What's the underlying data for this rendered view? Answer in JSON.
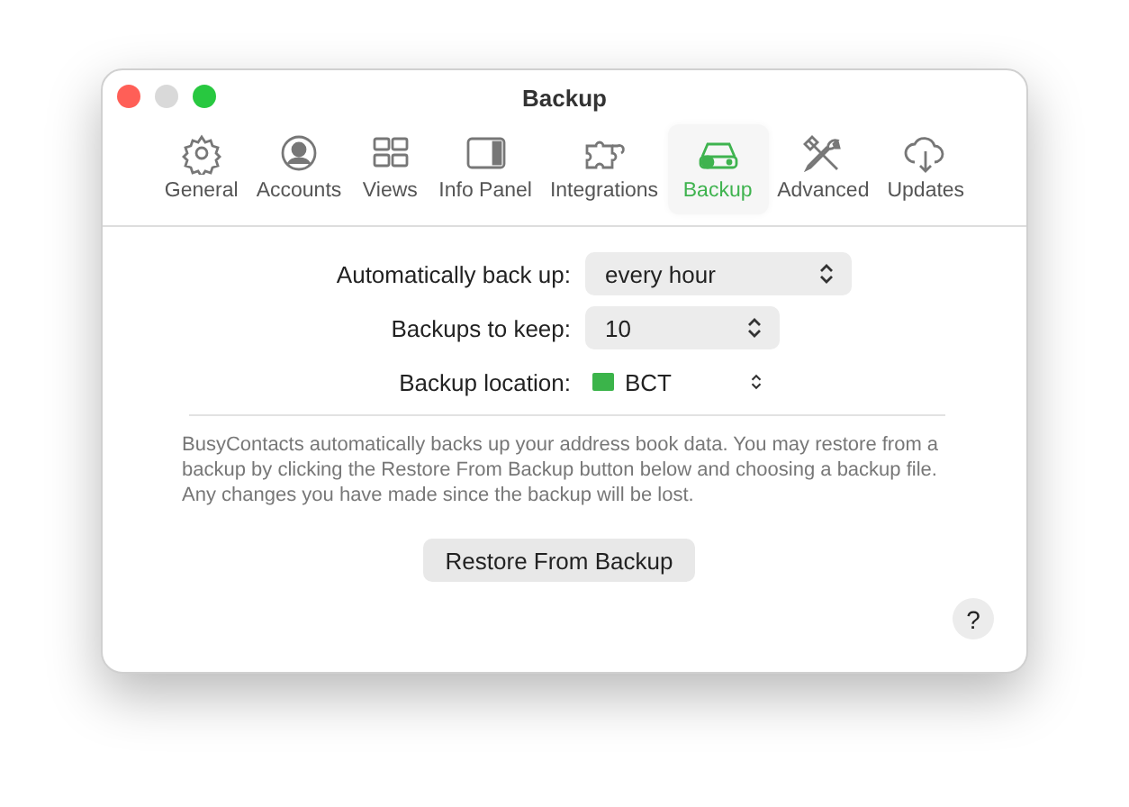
{
  "window": {
    "title": "Backup"
  },
  "tabs": [
    {
      "label": "General",
      "selected": false
    },
    {
      "label": "Accounts",
      "selected": false
    },
    {
      "label": "Views",
      "selected": false
    },
    {
      "label": "Info Panel",
      "selected": false
    },
    {
      "label": "Integrations",
      "selected": false
    },
    {
      "label": "Backup",
      "selected": true
    },
    {
      "label": "Advanced",
      "selected": false
    },
    {
      "label": "Updates",
      "selected": false
    }
  ],
  "settings": [
    {
      "label": "Automatically back up:",
      "value": "every hour",
      "kind": "popup"
    },
    {
      "label": "Backups to keep:",
      "value": "10",
      "kind": "popup"
    },
    {
      "label": "Backup location:",
      "value": "BCT",
      "kind": "folder"
    }
  ],
  "description": "BusyContacts automatically backs up your address book data. You may restore from a backup by clicking the Restore From Backup button below and choosing a backup file. Any changes you have made since the backup will be lost.",
  "restore_button": "Restore From Backup",
  "help_button": "?"
}
